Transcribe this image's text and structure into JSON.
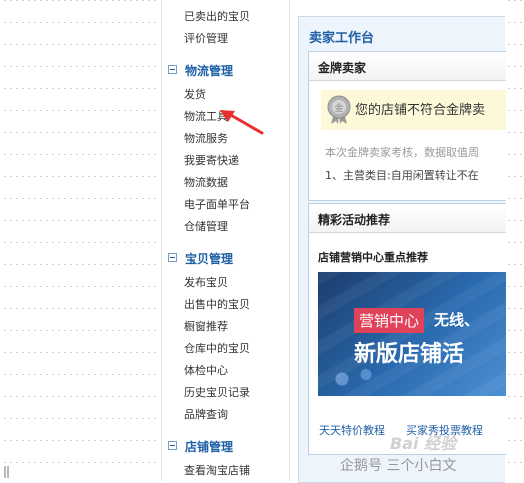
{
  "sidebar": {
    "items_top": [
      "已卖出的宝贝",
      "评价管理"
    ],
    "groups": [
      {
        "title": "物流管理",
        "items": [
          "发货",
          "物流工具",
          "物流服务",
          "我要寄快递",
          "物流数据",
          "电子面单平台",
          "仓储管理"
        ]
      },
      {
        "title": "宝贝管理",
        "items": [
          "发布宝贝",
          "出售中的宝贝",
          "橱窗推荐",
          "仓库中的宝贝",
          "体检中心",
          "历史宝贝记录",
          "品牌查询"
        ]
      },
      {
        "title": "店铺管理",
        "items": [
          "查看淘宝店铺"
        ]
      }
    ]
  },
  "main": {
    "workspace_title": "卖家工作台",
    "gold_card": {
      "title": "金牌卖家",
      "notice": "您的店铺不符合金牌卖",
      "note1": "本次金牌卖家考核，数据取值周",
      "note2": "1、主营类目:自用闲置转让不在"
    },
    "promo_card": {
      "title": "精彩活动推荐",
      "subtitle": "店铺营销中心重点推荐",
      "banner_badge": "营销中心",
      "banner_tag": "无线、",
      "banner_headline": "新版店铺活",
      "links": [
        "天天特价教程",
        "买家秀投票教程"
      ]
    }
  },
  "watermark": {
    "baidu": "Bai 经验",
    "author": "企鹅号 三个小白文"
  },
  "colors": {
    "accent": "#1f5fa6",
    "highlight": "#fdf9d8",
    "arrow": "#e8302f",
    "badge": "#e0425a"
  },
  "icons": {
    "medal": "medal-icon",
    "arrow": "red-arrow-icon",
    "toggle": "collapse-icon"
  }
}
